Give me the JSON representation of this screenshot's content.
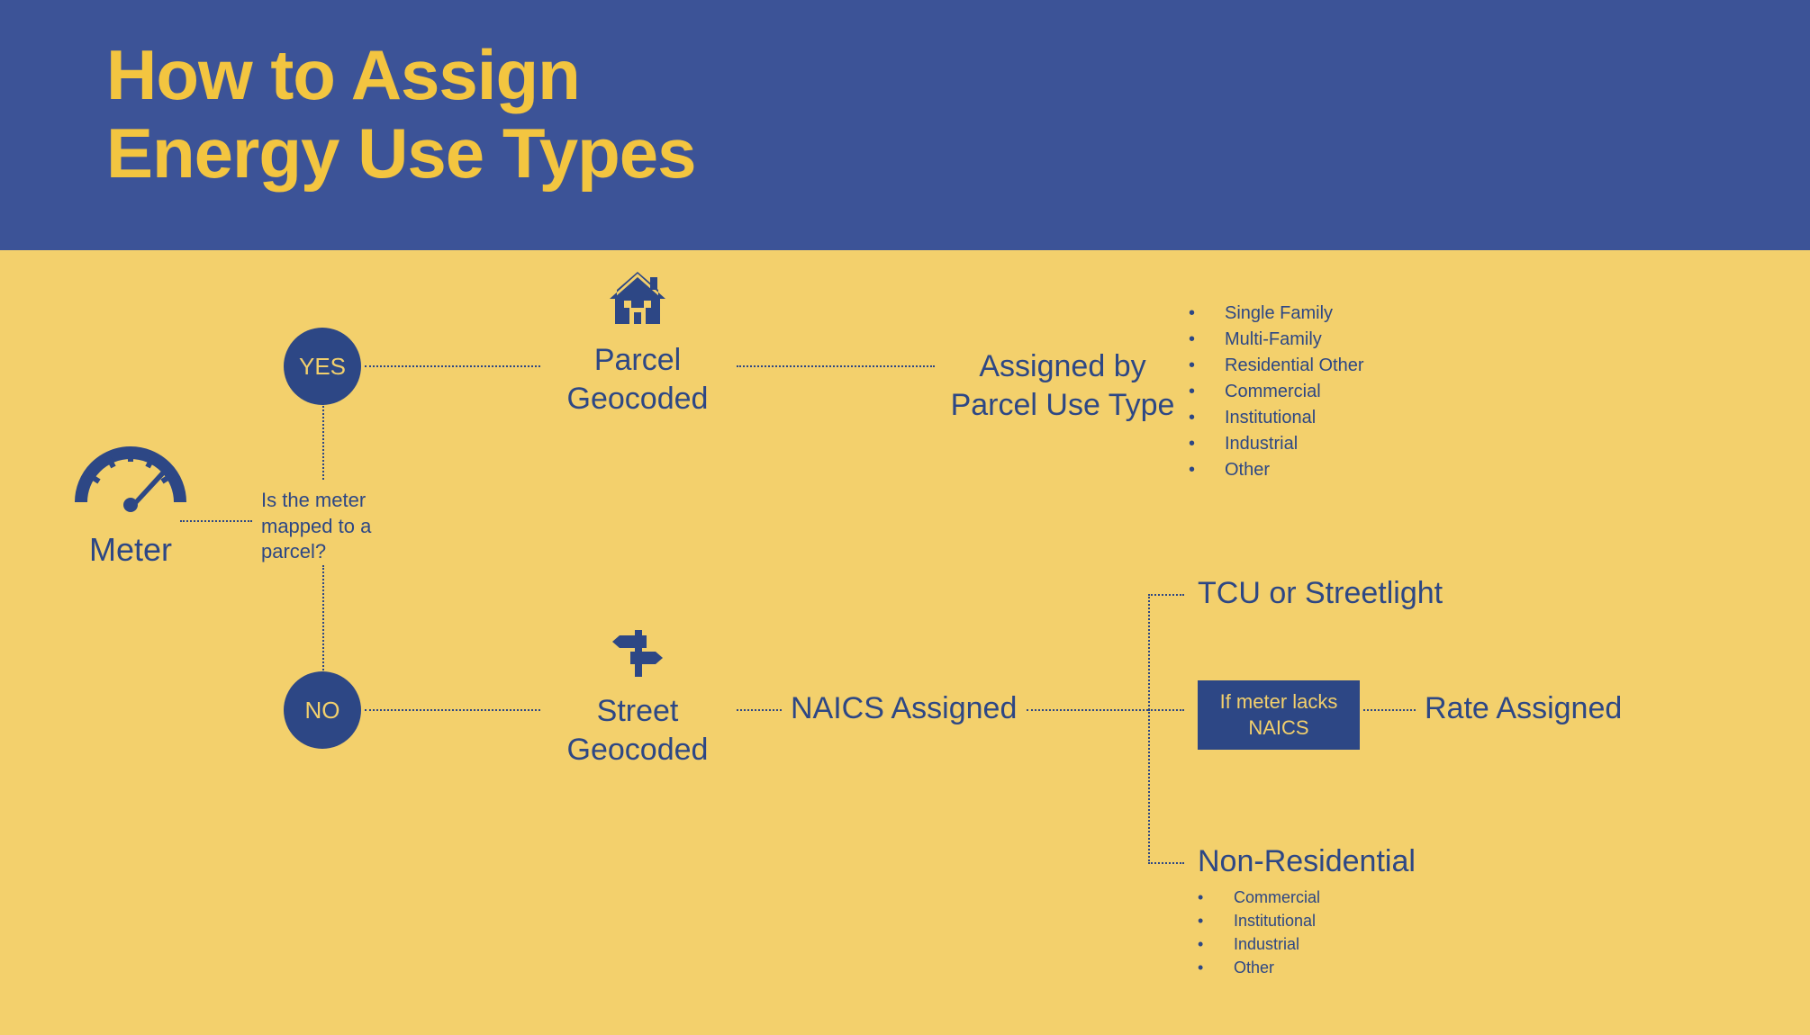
{
  "title_line1": "How to Assign",
  "title_line2": "Energy Use Types",
  "meter_label": "Meter",
  "question_l1": "Is the meter",
  "question_l2": "mapped to a",
  "question_l3": "parcel?",
  "yes": "YES",
  "no": "NO",
  "parcel_geocoded_l1": "Parcel",
  "parcel_geocoded_l2": "Geocoded",
  "assigned_by_l1": "Assigned by",
  "assigned_by_l2": "Parcel Use Type",
  "parcel_types": {
    "a": "Single Family",
    "b": "Multi-Family",
    "c": "Residential Other",
    "d": "Commercial",
    "e": "Institutional",
    "f": "Industrial",
    "g": "Other"
  },
  "street_geocoded_l1": "Street",
  "street_geocoded_l2": "Geocoded",
  "naics_assigned": "NAICS Assigned",
  "tcu_streetlight": "TCU or Streetlight",
  "if_lacks_l1": "If meter lacks",
  "if_lacks_l2": "NAICS",
  "rate_assigned": "Rate Assigned",
  "non_residential": "Non-Residential",
  "nonres_types": {
    "a": "Commercial",
    "b": "Institutional",
    "c": "Industrial",
    "d": "Other"
  }
}
